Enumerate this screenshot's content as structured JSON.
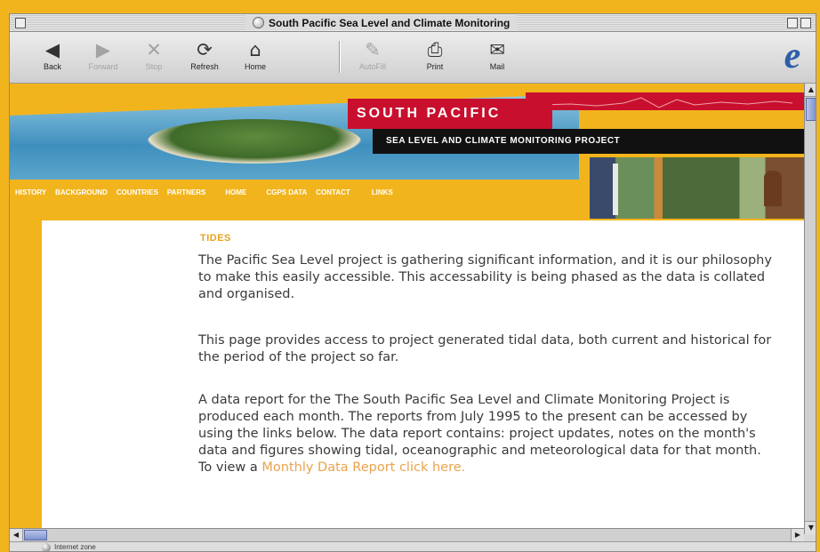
{
  "window": {
    "title": "South Pacific Sea Level and Climate Monitoring"
  },
  "toolbar": {
    "buttons": [
      {
        "label": "Back",
        "icon": "back-arrow-icon",
        "enabled": true
      },
      {
        "label": "Forward",
        "icon": "forward-arrow-icon",
        "enabled": false
      },
      {
        "label": "Stop",
        "icon": "stop-icon",
        "enabled": false
      },
      {
        "label": "Refresh",
        "icon": "refresh-icon",
        "enabled": true
      },
      {
        "label": "Home",
        "icon": "home-icon",
        "enabled": true
      },
      {
        "label": "AutoFill",
        "icon": "autofill-icon",
        "enabled": false
      },
      {
        "label": "Print",
        "icon": "printer-icon",
        "enabled": true
      },
      {
        "label": "Mail",
        "icon": "mail-icon",
        "enabled": true
      }
    ]
  },
  "banner": {
    "title": "SOUTH PACIFIC",
    "subtitle": "SEA LEVEL AND CLIMATE MONITORING PROJECT",
    "nav": [
      "HISTORY",
      "BACKGROUND",
      "COUNTRIES",
      "PARTNERS",
      "HOME",
      "CGPS DATA",
      "CONTACT",
      "LINKS"
    ],
    "accent_color": "#c8102e"
  },
  "content": {
    "heading": "TIDES",
    "para1": "The Pacific Sea Level project is gathering significant information, and it is our philosophy to make this easily accessible. This accessability is being phased as the data is collated and organised.",
    "para2": "This page provides access to project generated tidal data, both current and historical for the period of the project so far.",
    "para3": "A data report for the The South Pacific Sea Level and Climate Monitoring Project is produced each month. The reports from July 1995 to the present can be accessed by using the links below. The data report contains: project updates, notes on the month's data and figures showing tidal, oceanographic and meteorological data for that month. To view a ",
    "link_text": "Monthly Data Report click here."
  },
  "status": {
    "zone": "Internet zone"
  }
}
